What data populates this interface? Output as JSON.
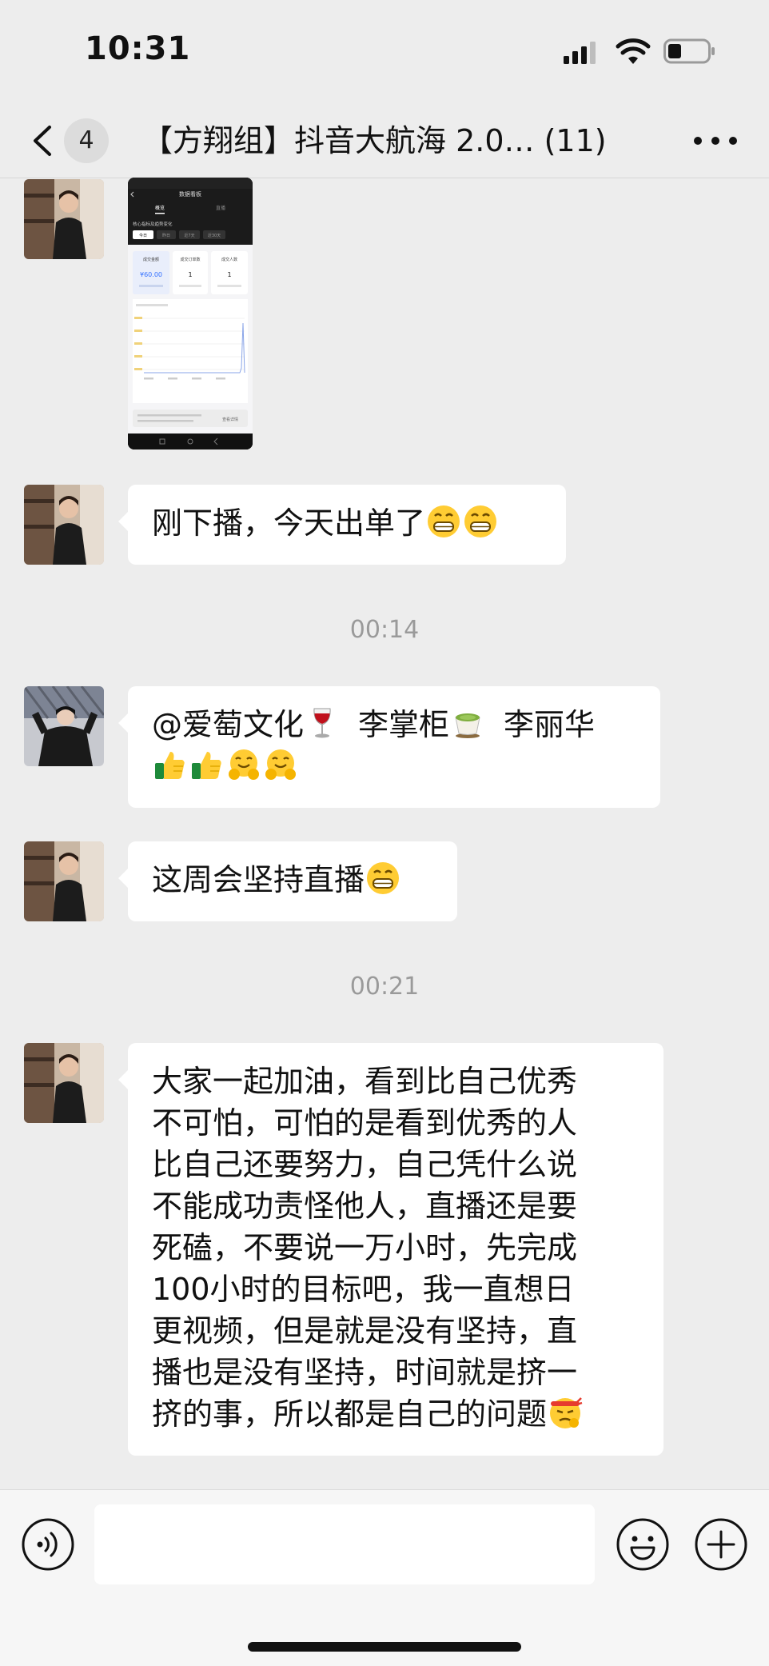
{
  "status_bar": {
    "time": "10:31"
  },
  "nav": {
    "unread_count": "4",
    "title": "【方翔组】抖音大航海 2.0… (11)"
  },
  "messages": {
    "m1": {
      "type": "image",
      "screen_title": "数据看板",
      "tabs": [
        "概览",
        "直播"
      ],
      "section": "核心指标及趋势变化",
      "pills": [
        "今日",
        "昨日",
        "近7天",
        "近30天"
      ],
      "kpis": [
        {
          "label": "成交金额",
          "value": "¥60.00"
        },
        {
          "label": "成交订单数",
          "value": "1"
        },
        {
          "label": "成交人数",
          "value": "1"
        }
      ],
      "footer_link": "查看详情"
    },
    "m2": {
      "text": "刚下播，今天出单了"
    },
    "ts1": "00:14",
    "m3": {
      "line1": "@爱萄文化",
      "name2": "李掌柜",
      "name3": "李丽华"
    },
    "m4": {
      "text": "这周会坚持直播"
    },
    "ts2": "00:21",
    "m5": {
      "lines": [
        "大家一起加油，看到比自己优秀",
        "不可怕，可怕的是看到优秀的人",
        "比自己还要努力，自己凭什么说",
        "不能成功责怪他人，直播还是要",
        "死磕，不要说一万小时，先完成",
        "100小时的目标吧，我一直想日",
        "更视频，但是就是没有坚持，直",
        "播也是没有坚持，时间就是挤一",
        "挤的事，所以都是自己的问题"
      ]
    }
  },
  "colors": {
    "background": "#ededed",
    "bubble": "#ffffff",
    "timestamp": "#9a9a9a"
  }
}
